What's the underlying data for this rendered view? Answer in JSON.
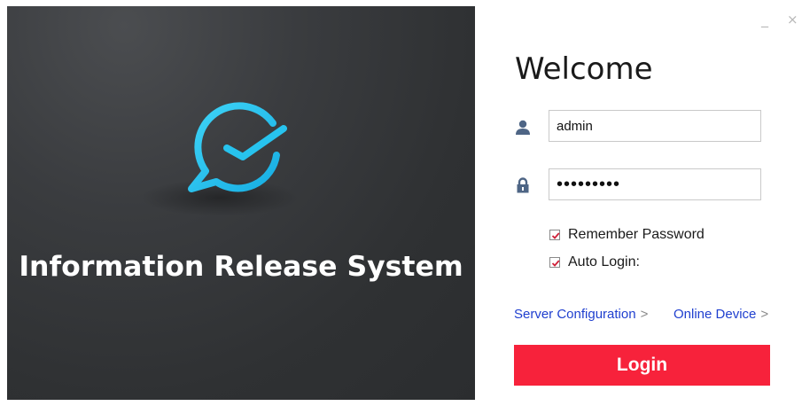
{
  "app": {
    "system_title": "Information Release System"
  },
  "window": {
    "minimize_glyph": "_",
    "close_glyph": "×"
  },
  "login": {
    "welcome": "Welcome",
    "username_value": "admin",
    "password_value": "•••••••••",
    "remember_password_label": "Remember Password",
    "remember_password_checked": true,
    "auto_login_label": "Auto Login:",
    "auto_login_checked": true,
    "server_config_link": "Server Configuration",
    "online_device_link": "Online Device",
    "chevron_glyph": ">",
    "login_button": "Login"
  },
  "colors": {
    "accent_red": "#f7223b",
    "logo_cyan": "#27c3ee",
    "link_blue": "#1f3fcf",
    "dark_panel": "#2f3133"
  },
  "icons": [
    "app-logo-icon",
    "user-icon",
    "lock-icon",
    "checkmark-icon",
    "chevron-right-icon",
    "minimize-icon",
    "close-icon"
  ]
}
